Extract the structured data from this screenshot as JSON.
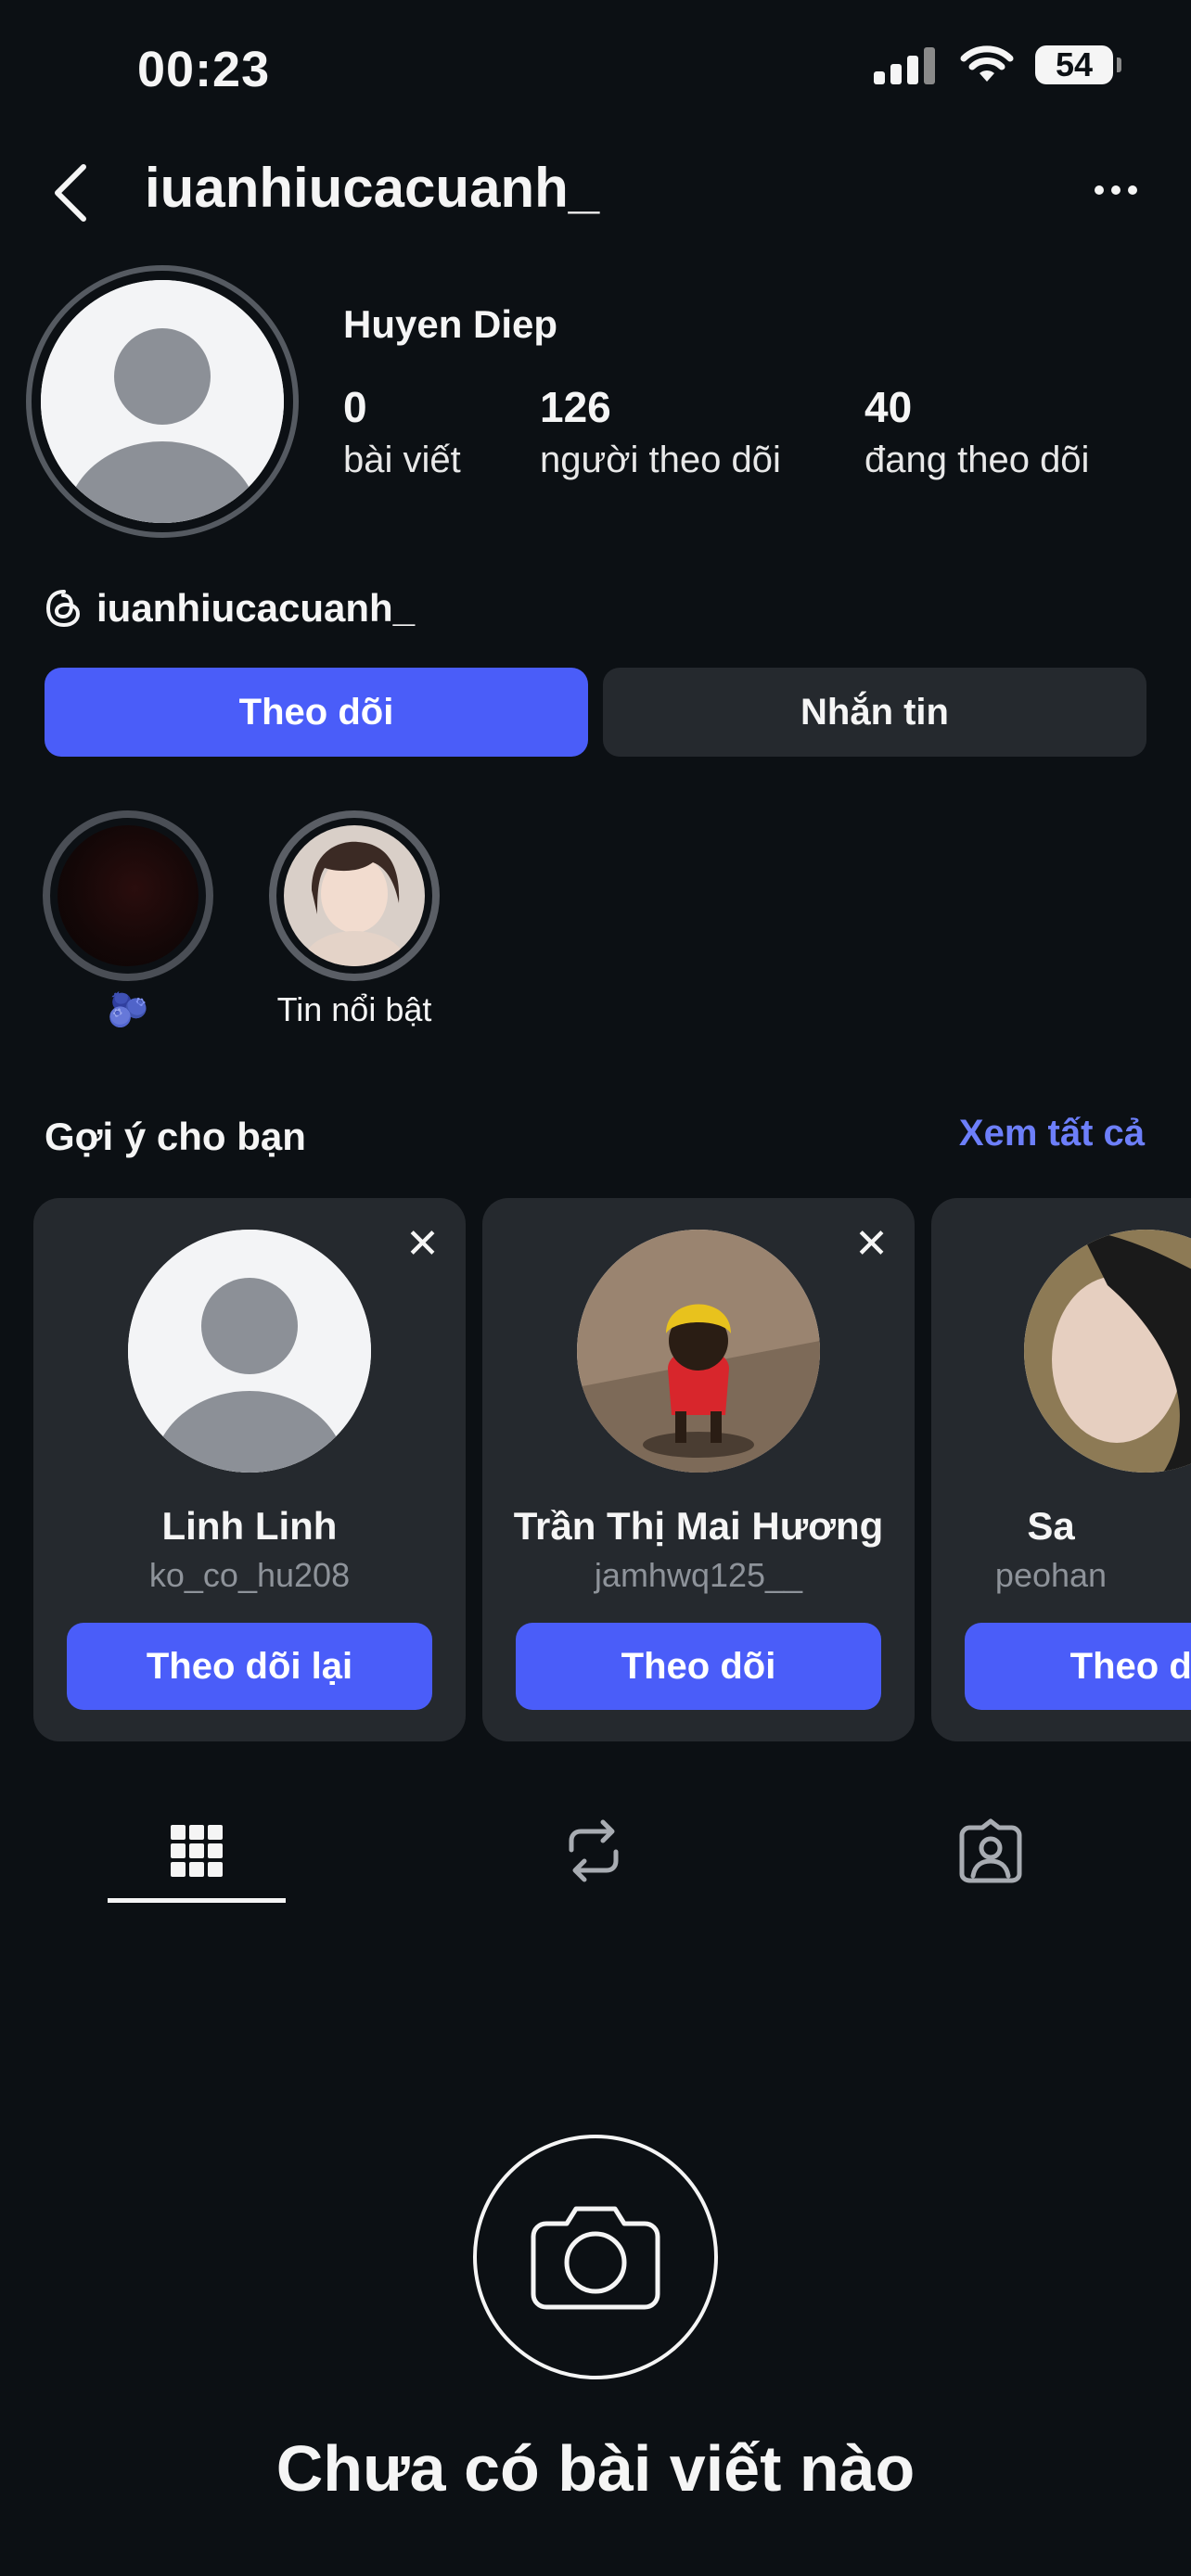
{
  "status_bar": {
    "time": "00:23",
    "battery": "54"
  },
  "header": {
    "username": "iuanhiucacuanh_"
  },
  "profile": {
    "display_name": "Huyen Diep",
    "stats": [
      {
        "value": "0",
        "label": "bài viết"
      },
      {
        "value": "126",
        "label": "người theo dõi"
      },
      {
        "value": "40",
        "label": "đang theo dõi"
      }
    ],
    "threads_handle": "iuanhiucacuanh_"
  },
  "actions": {
    "follow": "Theo dõi",
    "message": "Nhắn tin"
  },
  "highlights": [
    {
      "label": "🫐"
    },
    {
      "label": "Tin nổi bật"
    }
  ],
  "suggestions": {
    "title": "Gợi ý cho bạn",
    "see_all": "Xem tất cả",
    "cards": [
      {
        "name": "Linh Linh",
        "handle": "ko_co_hu208",
        "button": "Theo dõi lại"
      },
      {
        "name": "Trần Thị Mai Hương",
        "handle": "jamhwq125__",
        "button": "Theo dõi"
      },
      {
        "name": "Sa",
        "handle": "peohan",
        "button": "Theo dõi"
      }
    ]
  },
  "tabs": [
    "grid-icon",
    "reposts-icon",
    "tagged-icon"
  ],
  "empty_state": {
    "title": "Chưa có bài viết nào"
  },
  "colors": {
    "background": "#0c1014",
    "accent": "#4a5df9",
    "link": "#6d7ffa",
    "card": "#25292e"
  }
}
